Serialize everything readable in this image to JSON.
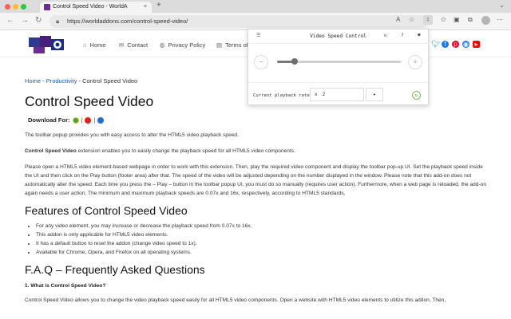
{
  "browser": {
    "tab_title": "Control Speed Video - WorldA",
    "tab_close": "×",
    "new_tab": "+",
    "tab_dropdown": "⌄",
    "url": "https://worldaddons.com/control-speed-video/",
    "reader_label": "A",
    "ext_label": "↕"
  },
  "nav": {
    "items": [
      {
        "icon": "⌂",
        "label": "Home"
      },
      {
        "icon": "✉",
        "label": "Contact"
      },
      {
        "icon": "◍",
        "label": "Privacy Policy"
      },
      {
        "icon": "▤",
        "label": "Terms of"
      }
    ]
  },
  "breadcrumb": {
    "home": "Home",
    "sep1": " - ",
    "category": "Productivity",
    "sep2": " - ",
    "current": "Control Speed Video"
  },
  "page": {
    "title": "Control Speed Video",
    "download_label": "Download For:",
    "download_sep": "|",
    "paragraphs": {
      "p1": "The toolbar popup provides you with easy access to alter the HTML5 video playback speed.",
      "p2_bold": "Control Speed Video",
      "p2_rest": " extension enables you to easily change the playback speed for all HTML5 video components.",
      "p3": "Please open a HTML5 video element-based webpage in order to work with this extension. Then, play the required video component and display the toolbar pop-up UI. Set the playback speed inside the UI and then click on the Play button (footer area) after that. The speed of the video will be adjusted depending on the number displayed in the window. Please note that this add-on does not automatically alter the speed. Each time you press the – Play – button in the toolbar popup UI, you must do so manually (requires user action). Furthermore, when a web page is reloaded, the add-on again needs a user action. The minimum and maximum playback speeds are 0.07x and 16x, respectively, according to HTML5 standards."
    },
    "features_heading": "Features of Control Speed Video",
    "features": [
      "For any video element, you may increase or decrease the playback speed from 0.07x to 16x.",
      "This addon is only applicable for HTML5 video elements.",
      "It has a default button to reset the addon (change video speed to 1x).",
      "Available for Chrome, Opera, and Firefox on all operating systems."
    ],
    "faq_heading": "F.A.Q – Frequently Asked Questions",
    "faq_q1": "1. What is Control Speed Video?",
    "faq_a1": "Control Speed Video allows you to change the video playback speed easily for all HTML5 video components. Open a website with HTML5 video elements to utilize this addon. Then,"
  },
  "popup": {
    "title": "Video Speed Control",
    "menu_icon": "☰",
    "refresh_icon": "↻",
    "help_icon": "?",
    "heart_icon": "♥",
    "minus_label": "−",
    "plus_label": "+",
    "slider_fraction": 0.14,
    "rate_label": "Current playback rate",
    "rate_prefix": "x",
    "rate_value": "2",
    "play_label": "▸",
    "reset_label": "↻"
  },
  "colors": {
    "link": "#1a5fb4",
    "accent_green": "#5aa33a",
    "twitter": "#1d9bf0",
    "facebook": "#1877f2",
    "pinterest": "#e60023",
    "youtube": "#ff0000"
  }
}
